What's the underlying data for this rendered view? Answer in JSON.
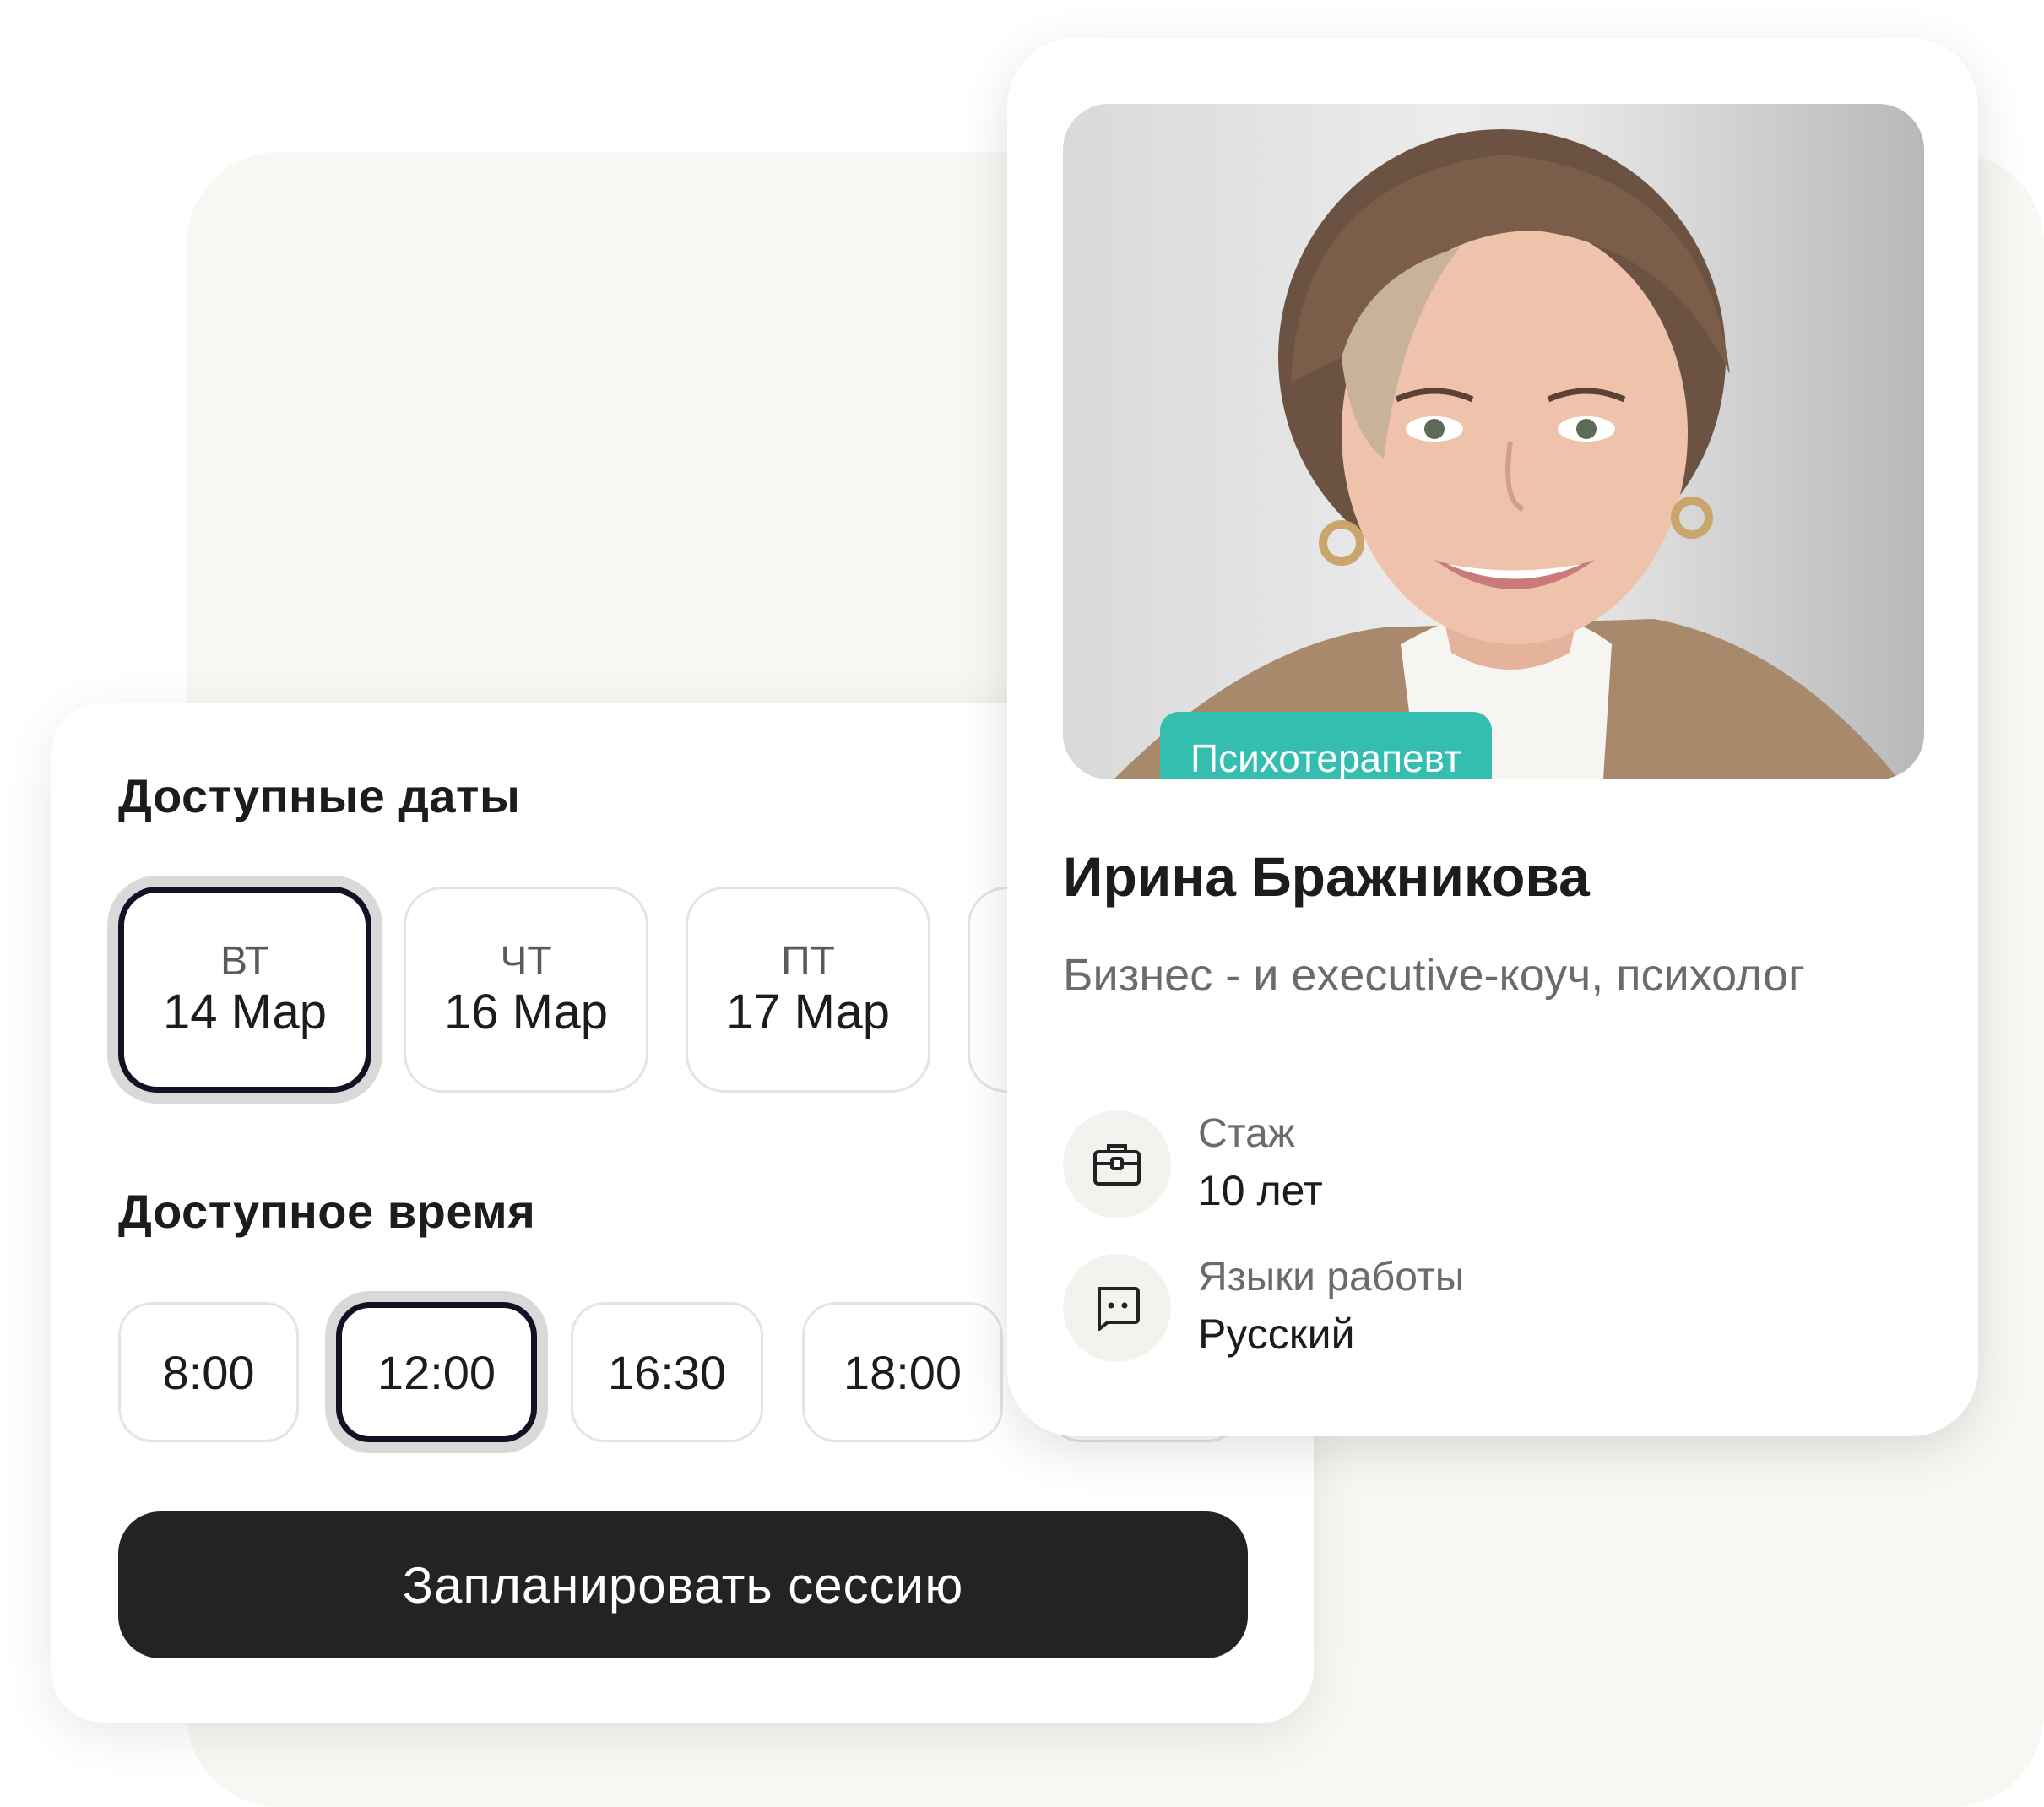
{
  "booking": {
    "dates_title": "Доступные даты",
    "dates": [
      {
        "dow": "ВТ",
        "date": "14 Мар",
        "selected": true
      },
      {
        "dow": "ЧТ",
        "date": "16 Мар",
        "selected": false
      },
      {
        "dow": "ПТ",
        "date": "17 Мар",
        "selected": false
      }
    ],
    "times_title": "Доступное время",
    "times": [
      {
        "label": "8:00",
        "selected": false
      },
      {
        "label": "12:00",
        "selected": true
      },
      {
        "label": "16:30",
        "selected": false
      },
      {
        "label": "18:00",
        "selected": false
      }
    ],
    "schedule_button": "Запланировать  сессию"
  },
  "profile": {
    "tag": "Психотерапевт",
    "name": "Ирина Бражникова",
    "subtitle": "Бизнес - и executive-коуч, психолог",
    "experience": {
      "label": "Стаж",
      "value": "10 лет",
      "icon": "briefcase-icon"
    },
    "languages": {
      "label": "Языки работы",
      "value": "Русский",
      "icon": "chat-bubble-icon"
    }
  },
  "colors": {
    "accent_teal": "#33beb0",
    "button_dark": "#232323",
    "selected_border": "#121226",
    "background_panel": "#f8f7f4"
  }
}
